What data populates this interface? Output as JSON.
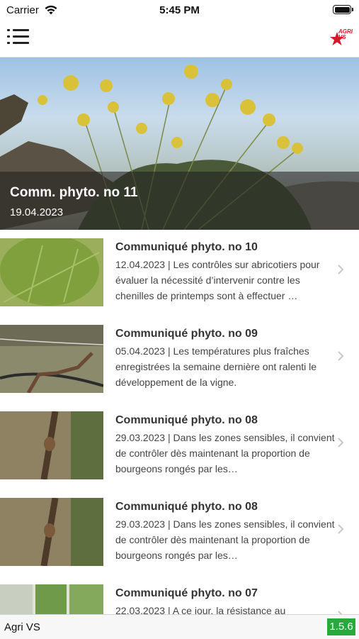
{
  "status_bar": {
    "carrier": "Carrier",
    "time": "5:45 PM"
  },
  "nav": {
    "menu_icon": "hamburger-menu-icon",
    "logo_text": "AGRI VS"
  },
  "hero": {
    "title": "Comm. phyto. no 11",
    "date": "19.04.2023"
  },
  "items": [
    {
      "title": "Communiqué phyto. no 10",
      "text": "12.04.2023 | Les contrôles sur abricotiers pour évaluer la nécessité d’intervenir contre les chenilles de printemps sont à effectuer …"
    },
    {
      "title": "Communiqué phyto. no 09",
      "text": "05.04.2023 | Les températures plus fraîches enregistrées la semaine dernière ont ralenti le développement de la vigne."
    },
    {
      "title": "Communiqué phyto. no 08",
      "text": "29.03.2023 | Dans les zones sensibles, il convient de contrôler dès maintenant la proportion de bourgeons rongés par les…"
    },
    {
      "title": "Communiqué phyto. no 08",
      "text": "29.03.2023 | Dans les zones sensibles, il convient de contrôler dès maintenant la proportion de bourgeons rongés par les…"
    },
    {
      "title": "Communiqué phyto. no 07",
      "text": "22.03.2023 | A ce jour, la résistance au"
    }
  ],
  "footer": {
    "app_name": "Agri VS",
    "version": "1.5.6"
  },
  "colors": {
    "accent_red": "#d51a2c",
    "version_green": "#27a93d"
  }
}
